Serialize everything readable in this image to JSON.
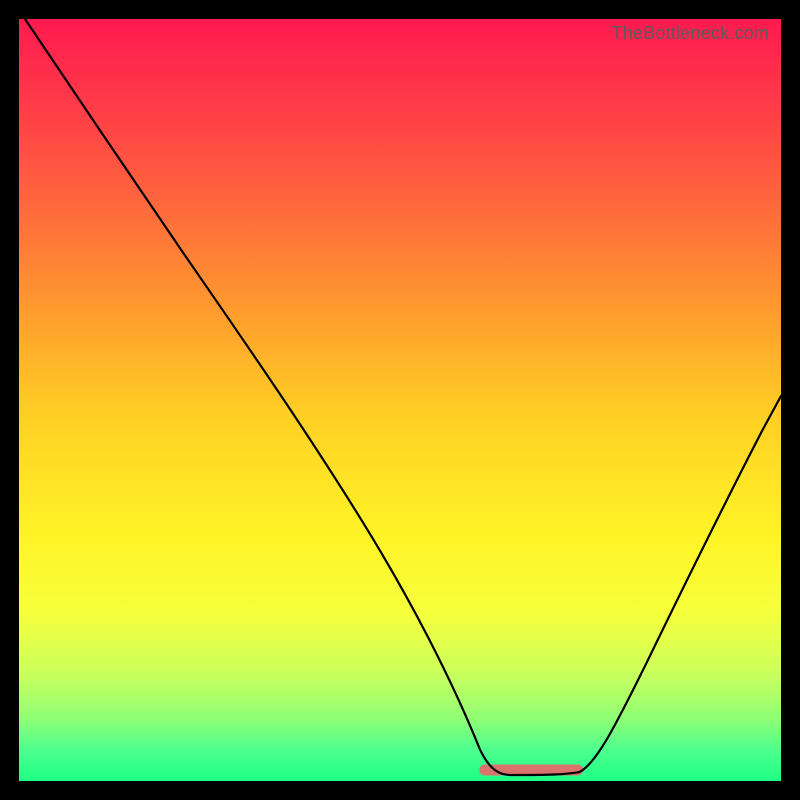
{
  "watermark": "TheBottleneck.com",
  "chart_data": {
    "type": "line",
    "title": "",
    "xlabel": "",
    "ylabel": "",
    "xlim": [
      0,
      100
    ],
    "ylim": [
      0,
      100
    ],
    "x": [
      0,
      5,
      10,
      15,
      20,
      25,
      30,
      35,
      40,
      45,
      50,
      55,
      58,
      60,
      62,
      65,
      67,
      70,
      73,
      76,
      80,
      85,
      90,
      95,
      100
    ],
    "values": [
      100,
      94,
      88,
      81,
      74,
      67,
      60,
      52,
      44,
      36,
      28,
      19,
      12,
      7,
      4,
      1.5,
      1,
      1,
      1.3,
      3,
      8,
      17,
      28,
      40,
      52
    ],
    "flat_bottom_range_x": [
      62,
      73
    ],
    "grid": false,
    "legend": false
  }
}
